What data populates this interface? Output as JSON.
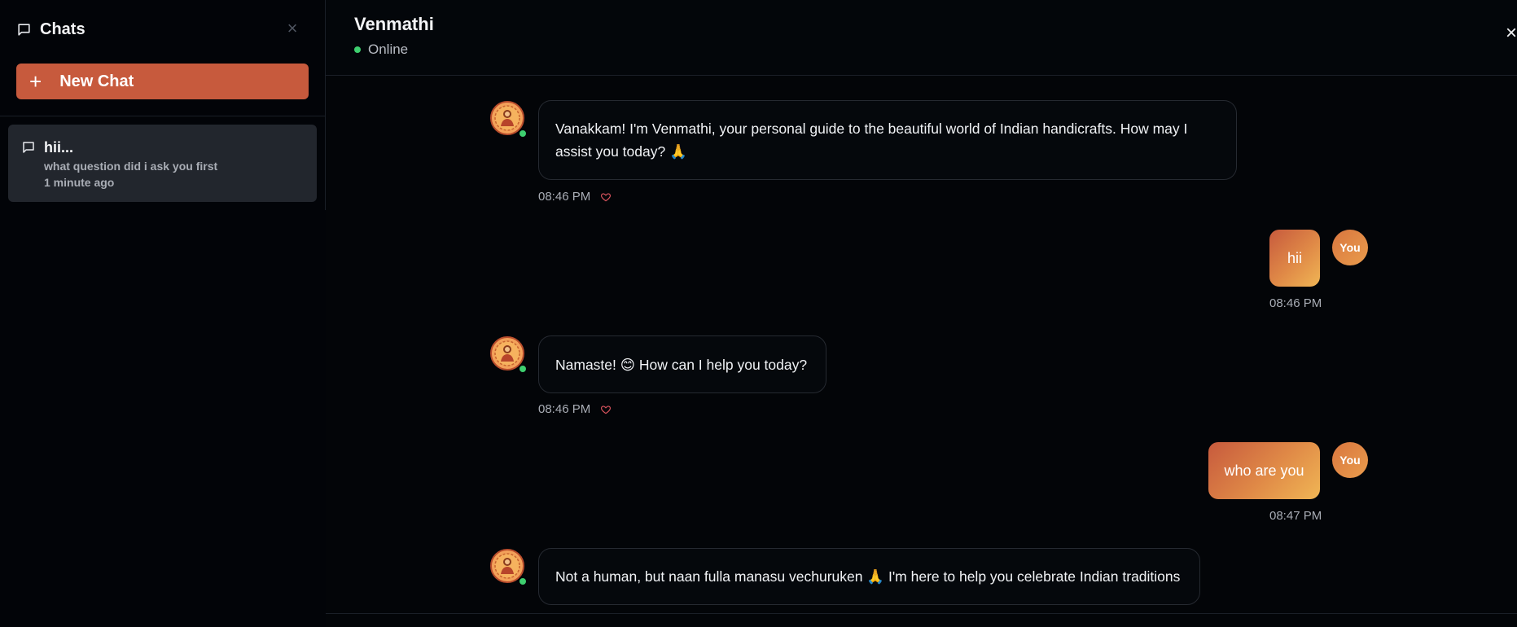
{
  "sidebar": {
    "title": "Chats",
    "close_label": "×",
    "new_chat_label": "New Chat",
    "conversations": [
      {
        "title": "hii...",
        "preview": "what question did i ask you first",
        "time": "1 minute ago"
      }
    ]
  },
  "header": {
    "name": "Venmathi",
    "status": "Online",
    "close_label": "×"
  },
  "messages": [
    {
      "role": "bot",
      "lines": [
        "Vanakkam! I'm Venmathi, your personal guide to the beautiful world of Indian handicrafts. How may I",
        "assist you today? 🙏"
      ],
      "time": "08:46 PM"
    },
    {
      "role": "user",
      "text": "hii",
      "avatar": "You",
      "time": "08:46 PM"
    },
    {
      "role": "bot",
      "lines": [
        "Namaste! 😊 How can I help you today?"
      ],
      "time": "08:46 PM"
    },
    {
      "role": "user",
      "text": "who are you",
      "avatar": "You",
      "time": "08:47 PM"
    },
    {
      "role": "bot",
      "lines": [
        "Not a human, but naan fulla manasu vechuruken 🙏 I'm here to help you celebrate Indian traditions"
      ]
    }
  ],
  "colors": {
    "accent": "#c75a3d",
    "online": "#3ecf6f",
    "background": "#030508",
    "heart": "#d9545e"
  },
  "icons": {
    "chat": "chat-bubble-icon",
    "close": "close-icon",
    "plus": "plus-icon",
    "heart": "heart-icon",
    "bot_avatar": "venmathi-avatar-icon"
  }
}
